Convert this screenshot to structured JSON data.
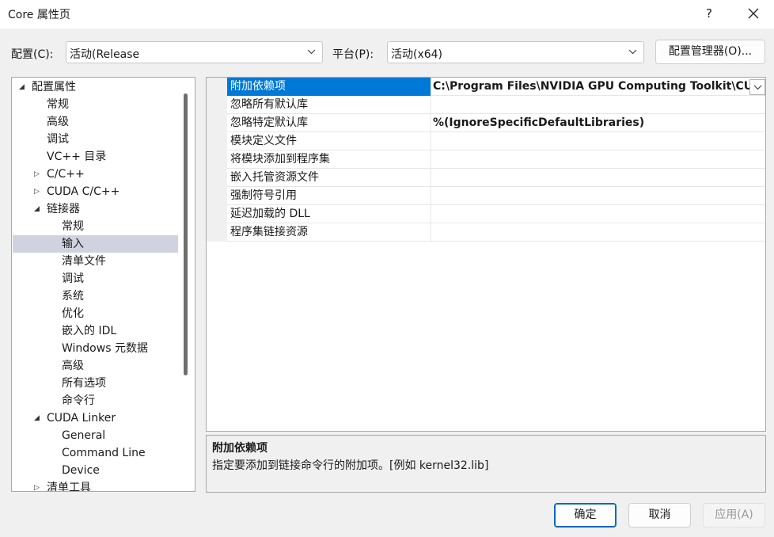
{
  "window": {
    "title": "Core 属性页",
    "help": "?"
  },
  "toolbar": {
    "config_label": "配置(C):",
    "config_value": "活动(Release",
    "platform_label": "平台(P):",
    "platform_value": "活动(x64)",
    "config_manager": "配置管理器(O)..."
  },
  "tree": [
    {
      "label": "配置属性",
      "depth": 0,
      "expander": "open"
    },
    {
      "label": "常规",
      "depth": 1,
      "expander": "none"
    },
    {
      "label": "高级",
      "depth": 1,
      "expander": "none"
    },
    {
      "label": "调试",
      "depth": 1,
      "expander": "none"
    },
    {
      "label": "VC++ 目录",
      "depth": 1,
      "expander": "none"
    },
    {
      "label": "C/C++",
      "depth": 1,
      "expander": "closed"
    },
    {
      "label": "CUDA C/C++",
      "depth": 1,
      "expander": "closed"
    },
    {
      "label": "链接器",
      "depth": 1,
      "expander": "open"
    },
    {
      "label": "常规",
      "depth": 2,
      "expander": "none"
    },
    {
      "label": "输入",
      "depth": 2,
      "expander": "none",
      "selected": true
    },
    {
      "label": "清单文件",
      "depth": 2,
      "expander": "none"
    },
    {
      "label": "调试",
      "depth": 2,
      "expander": "none"
    },
    {
      "label": "系统",
      "depth": 2,
      "expander": "none"
    },
    {
      "label": "优化",
      "depth": 2,
      "expander": "none"
    },
    {
      "label": "嵌入的 IDL",
      "depth": 2,
      "expander": "none"
    },
    {
      "label": "Windows 元数据",
      "depth": 2,
      "expander": "none"
    },
    {
      "label": "高级",
      "depth": 2,
      "expander": "none"
    },
    {
      "label": "所有选项",
      "depth": 2,
      "expander": "none"
    },
    {
      "label": "命令行",
      "depth": 2,
      "expander": "none"
    },
    {
      "label": "CUDA Linker",
      "depth": 1,
      "expander": "open"
    },
    {
      "label": "General",
      "depth": 2,
      "expander": "none"
    },
    {
      "label": "Command Line",
      "depth": 2,
      "expander": "none"
    },
    {
      "label": "Device",
      "depth": 2,
      "expander": "none"
    },
    {
      "label": "清单工具",
      "depth": 1,
      "expander": "closed"
    }
  ],
  "properties": [
    {
      "name": "附加依赖项",
      "value": "C:\\Program Files\\NVIDIA GPU Computing Toolkit\\CU",
      "selected": true
    },
    {
      "name": "忽略所有默认库",
      "value": ""
    },
    {
      "name": "忽略特定默认库",
      "value": "%(IgnoreSpecificDefaultLibraries)"
    },
    {
      "name": "模块定义文件",
      "value": ""
    },
    {
      "name": "将模块添加到程序集",
      "value": ""
    },
    {
      "name": "嵌入托管资源文件",
      "value": ""
    },
    {
      "name": "强制符号引用",
      "value": ""
    },
    {
      "name": "延迟加载的 DLL",
      "value": ""
    },
    {
      "name": "程序集链接资源",
      "value": ""
    }
  ],
  "description": {
    "title": "附加依赖项",
    "text": "指定要添加到链接命令行的附加项。[例如 kernel32.lib]"
  },
  "buttons": {
    "ok": "确定",
    "cancel": "取消",
    "apply": "应用(A)"
  }
}
